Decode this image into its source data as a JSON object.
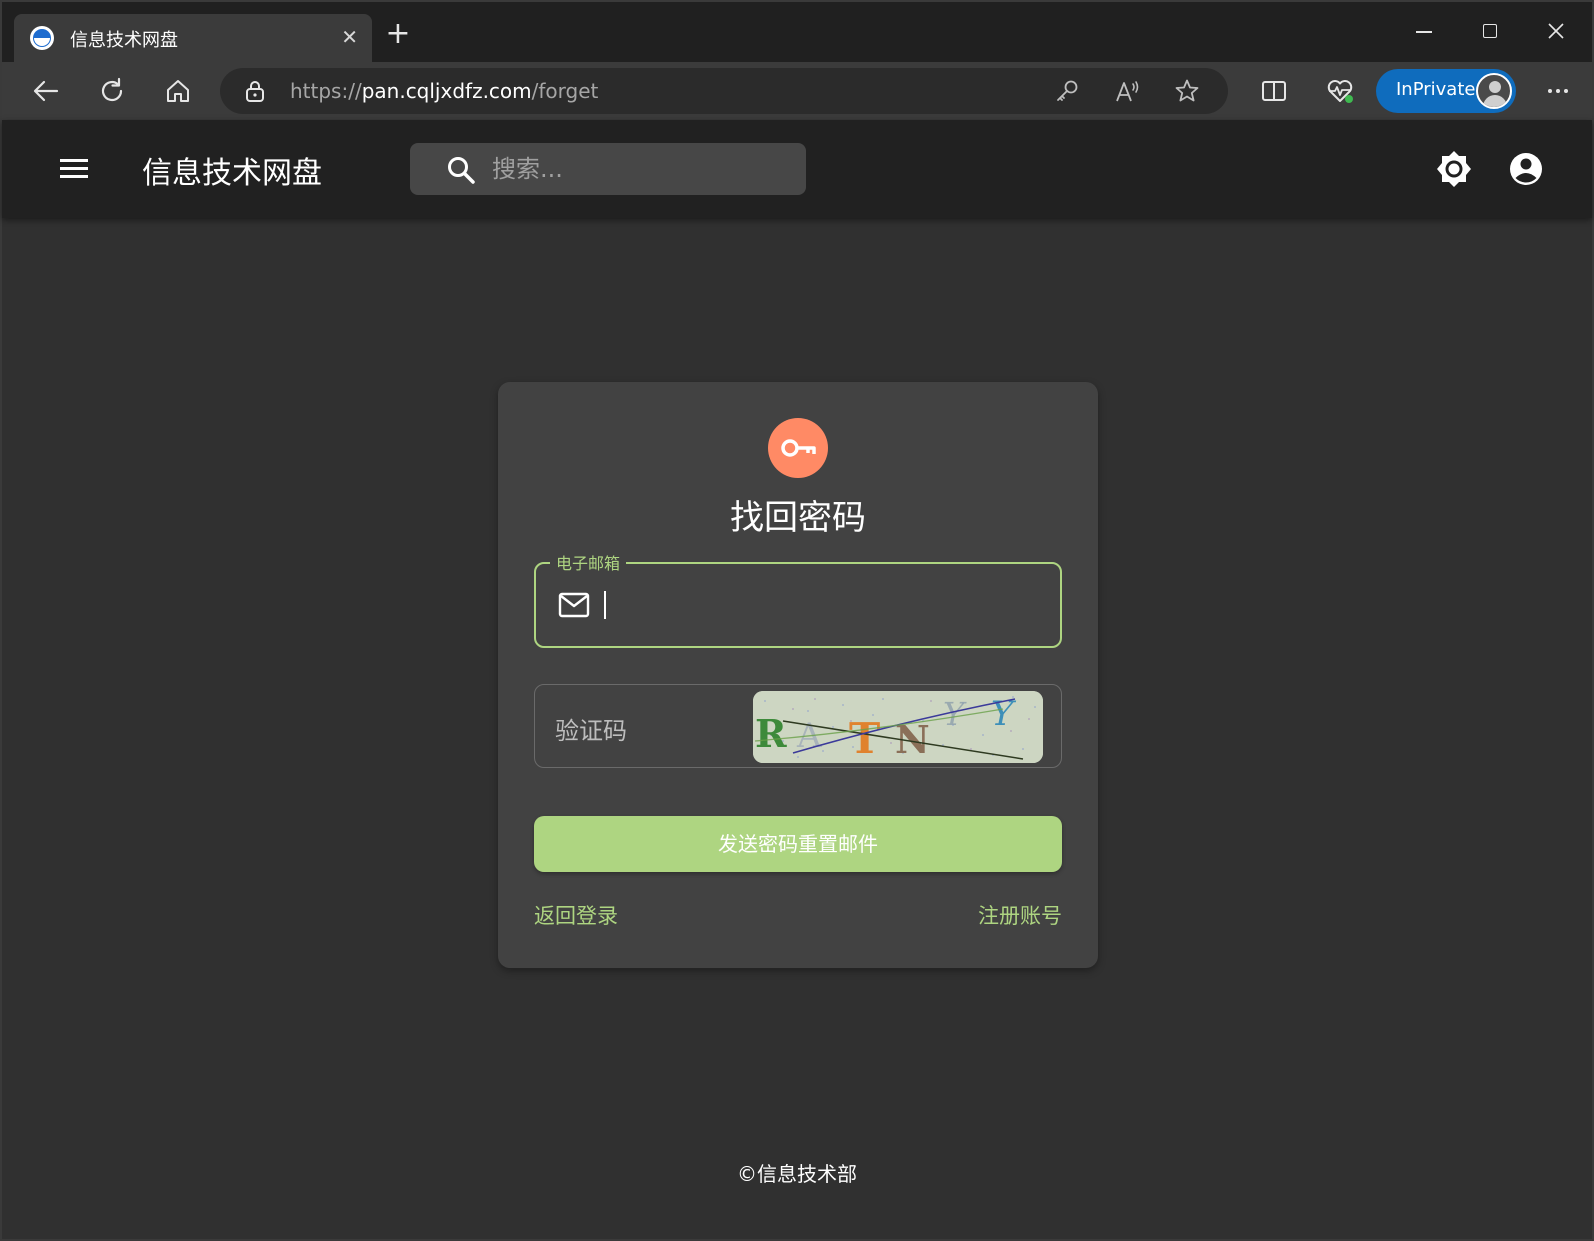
{
  "browser": {
    "tab_title": "信息技术网盘",
    "url_scheme": "https://",
    "url_host": "pan.cqljxdfz.com",
    "url_path": "/forget",
    "inprivate_label": "InPrivate",
    "new_tab_symbol": "+",
    "close_symbol": "✕"
  },
  "app": {
    "title": "信息技术网盘",
    "search_placeholder": "搜索..."
  },
  "form": {
    "title": "找回密码",
    "email_label": "电子邮箱",
    "email_value": "",
    "captcha_label": "验证码",
    "captcha_text": "RATNYY",
    "submit_label": "发送密码重置邮件",
    "back_to_login": "返回登录",
    "register": "注册账号"
  },
  "footer": {
    "copyright": "©信息技术部"
  },
  "colors": {
    "accent": "#aed581",
    "icon_badge": "#ff8a65",
    "card_bg": "#424242",
    "page_bg": "#303030",
    "header_bg": "#212121",
    "inprivate_bg": "#0f6cbd"
  },
  "icons": {
    "tab_favicon": "edge-logo-icon",
    "back": "arrow-left-icon",
    "refresh": "refresh-icon",
    "home": "home-icon",
    "lock": "lock-icon",
    "key_addr": "key-icon",
    "read_aloud": "read-aloud-icon",
    "favorite": "star-icon",
    "split_screen": "split-screen-icon",
    "health": "heart-pulse-icon",
    "more": "more-icon",
    "menu": "hamburger-menu-icon",
    "search": "search-icon",
    "theme": "brightness-icon",
    "account": "account-circle-icon",
    "card_key": "vpn-key-icon",
    "mail": "mail-icon"
  }
}
